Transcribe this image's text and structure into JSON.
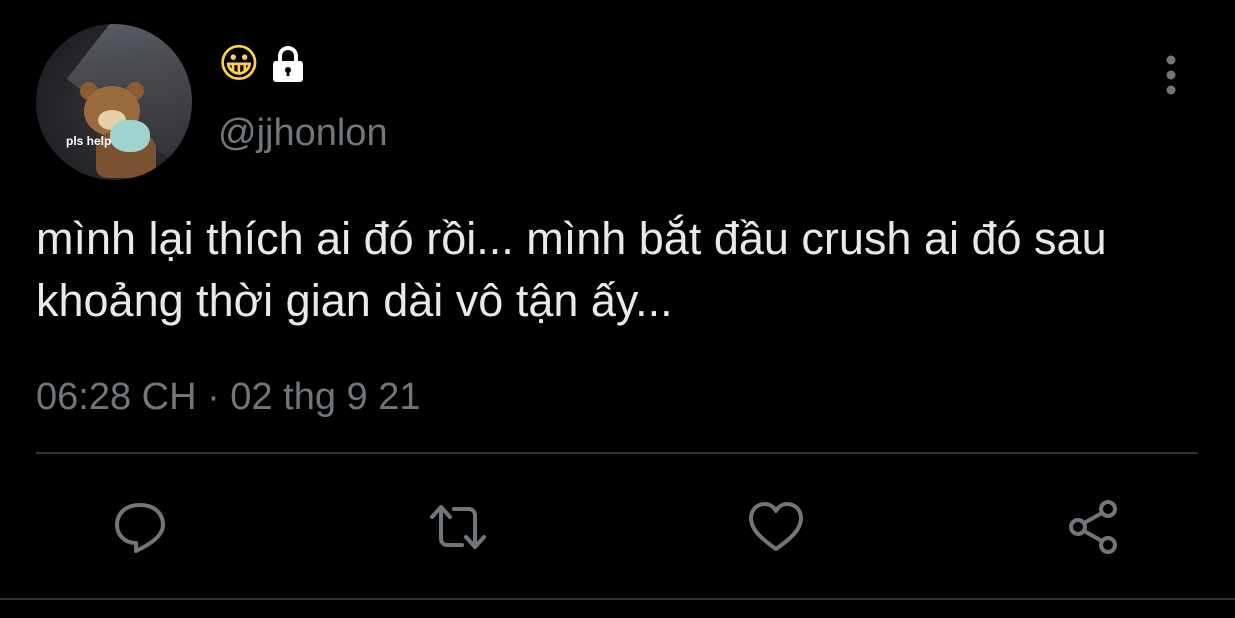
{
  "author": {
    "avatar_caption": "pls help",
    "display_name_emoji": "😀",
    "handle": "@jjhonlon"
  },
  "tweet": {
    "text": "mình lại thích ai đó rồi... mình bắt đầu crush ai đó sau khoảng thời gian dài vô tận ấy...",
    "timestamp": "06:28 CH · 02 thg 9 21"
  },
  "icons": {
    "lock": "lock-icon",
    "more": "more-vertical-icon",
    "reply": "reply-icon",
    "retweet": "retweet-icon",
    "like": "heart-icon",
    "share": "share-icon"
  },
  "colors": {
    "background": "#000000",
    "text_primary": "#e7e9ea",
    "text_secondary": "#71767b",
    "icon": "#71767b",
    "divider": "#2f3336"
  }
}
